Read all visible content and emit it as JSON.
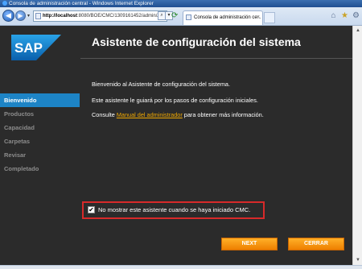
{
  "window": {
    "title": "Consola de administración central - Windows Internet Explorer"
  },
  "browser": {
    "address": {
      "host": "http://localhost",
      "path": ":8080/BOE/CMC/1309161452/admin/App"
    },
    "tab_title": "Consola de administración ce...",
    "nav_dropdown": "▾",
    "search_btn": "⌕",
    "drop_btn": "▾",
    "reload": "⟳",
    "tab_close": "×",
    "icons": {
      "home": "⌂",
      "favorites": "★",
      "tools": "⚙"
    }
  },
  "sidebar": {
    "logo_text": "SAP",
    "items": [
      {
        "label": "Bienvenido",
        "active": true
      },
      {
        "label": "Productos"
      },
      {
        "label": "Capacidad"
      },
      {
        "label": "Carpetas"
      },
      {
        "label": "Revisar"
      },
      {
        "label": "Completado"
      }
    ]
  },
  "main": {
    "heading": "Asistente de configuración del sistema",
    "p1": "Bienvenido al Asistente de configuración del sistema.",
    "p2": "Este asistente le guiará por los pasos de configuración iniciales.",
    "p3_prefix": "Consulte ",
    "p3_link": "Manual del administrador",
    "p3_suffix": " para obtener más información.",
    "checkbox_label": "No mostrar este asistente cuando se haya iniciado CMC.",
    "checkbox_checked": "✔",
    "next_label": "NEXT",
    "close_label": "CERRAR"
  },
  "colors": {
    "accent": "#1d84c6",
    "button": "#ee7f00",
    "link": "#f0a800",
    "highlight_border": "#d72a2a",
    "background": "#2b2b2b"
  }
}
